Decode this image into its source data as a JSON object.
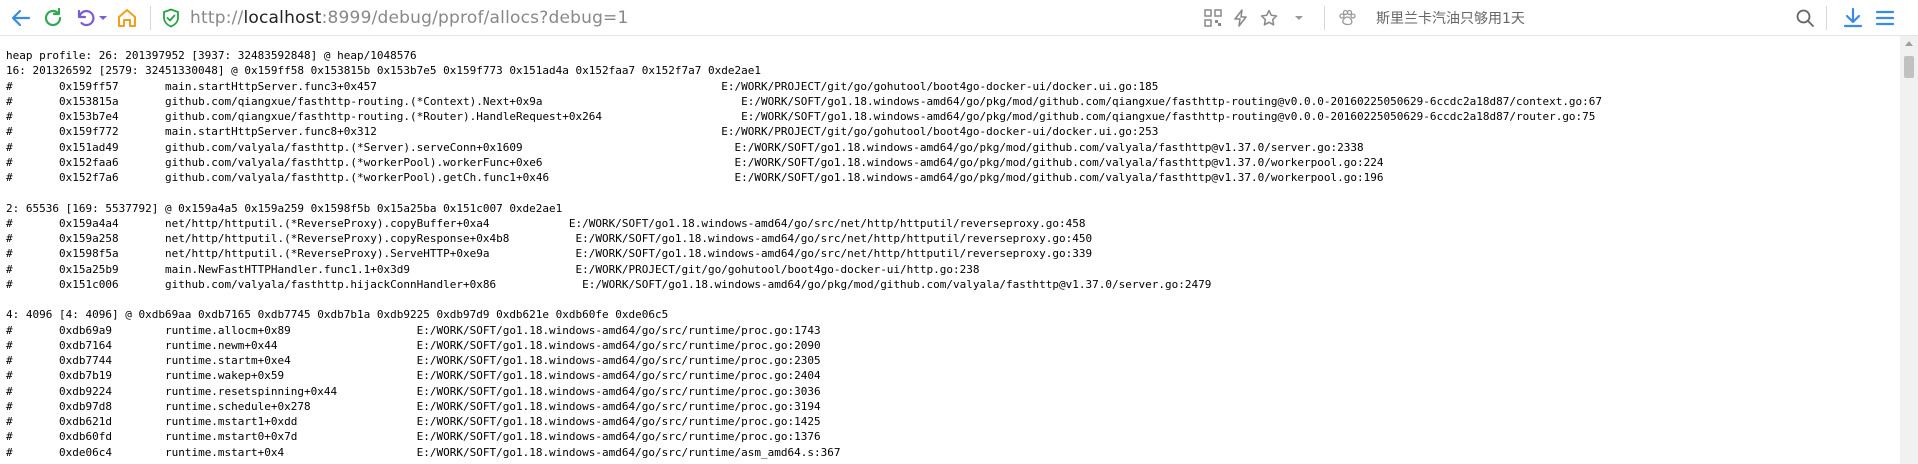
{
  "browser": {
    "url_prefix": "http://",
    "url_host": "localhost",
    "url_rest": ":8999/debug/pprof/allocs?debug=1",
    "search_placeholder": "斯里兰卡汽油只够用1天",
    "colors": {
      "accent_blue": "#3b8ae6",
      "refresh_green": "#32a852",
      "undo_purple": "#7b5cd6",
      "home_orange": "#f0a020",
      "shield_green": "#25a244"
    }
  },
  "profile": {
    "lines": [
      "heap profile: 26: 201397952 [3937: 32483592848] @ heap/1048576",
      "16: 201326592 [2579: 32451330048] @ 0x159ff58 0x153815b 0x153b7e5 0x159f773 0x151ad4a 0x152faa7 0x152f7a7 0xde2ae1",
      "#\t0x159ff57\tmain.startHttpServer.func3+0x457                                                    E:/WORK/PROJECT/git/go/gohutool/boot4go-docker-ui/docker.ui.go:185",
      "#\t0x153815a\tgithub.com/qiangxue/fasthttp-routing.(*Context).Next+0x9a                              E:/WORK/SOFT/go1.18.windows-amd64/go/pkg/mod/github.com/qiangxue/fasthttp-routing@v0.0.0-20160225050629-6ccdc2a18d87/context.go:67",
      "#\t0x153b7e4\tgithub.com/qiangxue/fasthttp-routing.(*Router).HandleRequest+0x264                     E:/WORK/SOFT/go1.18.windows-amd64/go/pkg/mod/github.com/qiangxue/fasthttp-routing@v0.0.0-20160225050629-6ccdc2a18d87/router.go:75",
      "#\t0x159f772\tmain.startHttpServer.func8+0x312                                                    E:/WORK/PROJECT/git/go/gohutool/boot4go-docker-ui/docker.ui.go:253",
      "#\t0x151ad49\tgithub.com/valyala/fasthttp.(*Server).serveConn+0x1609                                E:/WORK/SOFT/go1.18.windows-amd64/go/pkg/mod/github.com/valyala/fasthttp@v1.37.0/server.go:2338",
      "#\t0x152faa6\tgithub.com/valyala/fasthttp.(*workerPool).workerFunc+0xe6                             E:/WORK/SOFT/go1.18.windows-amd64/go/pkg/mod/github.com/valyala/fasthttp@v1.37.0/workerpool.go:224",
      "#\t0x152f7a6\tgithub.com/valyala/fasthttp.(*workerPool).getCh.func1+0x46                            E:/WORK/SOFT/go1.18.windows-amd64/go/pkg/mod/github.com/valyala/fasthttp@v1.37.0/workerpool.go:196",
      "",
      "2: 65536 [169: 5537792] @ 0x159a4a5 0x159a259 0x1598f5b 0x15a25ba 0x151c007 0xde2ae1",
      "#\t0x159a4a4\tnet/http/httputil.(*ReverseProxy).copyBuffer+0xa4            E:/WORK/SOFT/go1.18.windows-amd64/go/src/net/http/httputil/reverseproxy.go:458",
      "#\t0x159a258\tnet/http/httputil.(*ReverseProxy).copyResponse+0x4b8          E:/WORK/SOFT/go1.18.windows-amd64/go/src/net/http/httputil/reverseproxy.go:450",
      "#\t0x1598f5a\tnet/http/httputil.(*ReverseProxy).ServeHTTP+0xe9a             E:/WORK/SOFT/go1.18.windows-amd64/go/src/net/http/httputil/reverseproxy.go:339",
      "#\t0x15a25b9\tmain.NewFastHTTPHandler.func1.1+0x3d9                         E:/WORK/PROJECT/git/go/gohutool/boot4go-docker-ui/http.go:238",
      "#\t0x151c006\tgithub.com/valyala/fasthttp.hijackConnHandler+0x86             E:/WORK/SOFT/go1.18.windows-amd64/go/pkg/mod/github.com/valyala/fasthttp@v1.37.0/server.go:2479",
      "",
      "4: 4096 [4: 4096] @ 0xdb69aa 0xdb7165 0xdb7745 0xdb7b1a 0xdb9225 0xdb97d9 0xdb621e 0xdb60fe 0xde06c5",
      "#\t0xdb69a9\truntime.allocm+0x89                   E:/WORK/SOFT/go1.18.windows-amd64/go/src/runtime/proc.go:1743",
      "#\t0xdb7164\truntime.newm+0x44                     E:/WORK/SOFT/go1.18.windows-amd64/go/src/runtime/proc.go:2090",
      "#\t0xdb7744\truntime.startm+0xe4                   E:/WORK/SOFT/go1.18.windows-amd64/go/src/runtime/proc.go:2305",
      "#\t0xdb7b19\truntime.wakep+0x59                    E:/WORK/SOFT/go1.18.windows-amd64/go/src/runtime/proc.go:2404",
      "#\t0xdb9224\truntime.resetspinning+0x44            E:/WORK/SOFT/go1.18.windows-amd64/go/src/runtime/proc.go:3036",
      "#\t0xdb97d8\truntime.schedule+0x278                E:/WORK/SOFT/go1.18.windows-amd64/go/src/runtime/proc.go:3194",
      "#\t0xdb621d\truntime.mstart1+0xdd                  E:/WORK/SOFT/go1.18.windows-amd64/go/src/runtime/proc.go:1425",
      "#\t0xdb60fd\truntime.mstart0+0x7d                  E:/WORK/SOFT/go1.18.windows-amd64/go/src/runtime/proc.go:1376",
      "#\t0xde06c4\truntime.mstart+0x4                    E:/WORK/SOFT/go1.18.windows-amd64/go/src/runtime/asm_amd64.s:367"
    ]
  }
}
